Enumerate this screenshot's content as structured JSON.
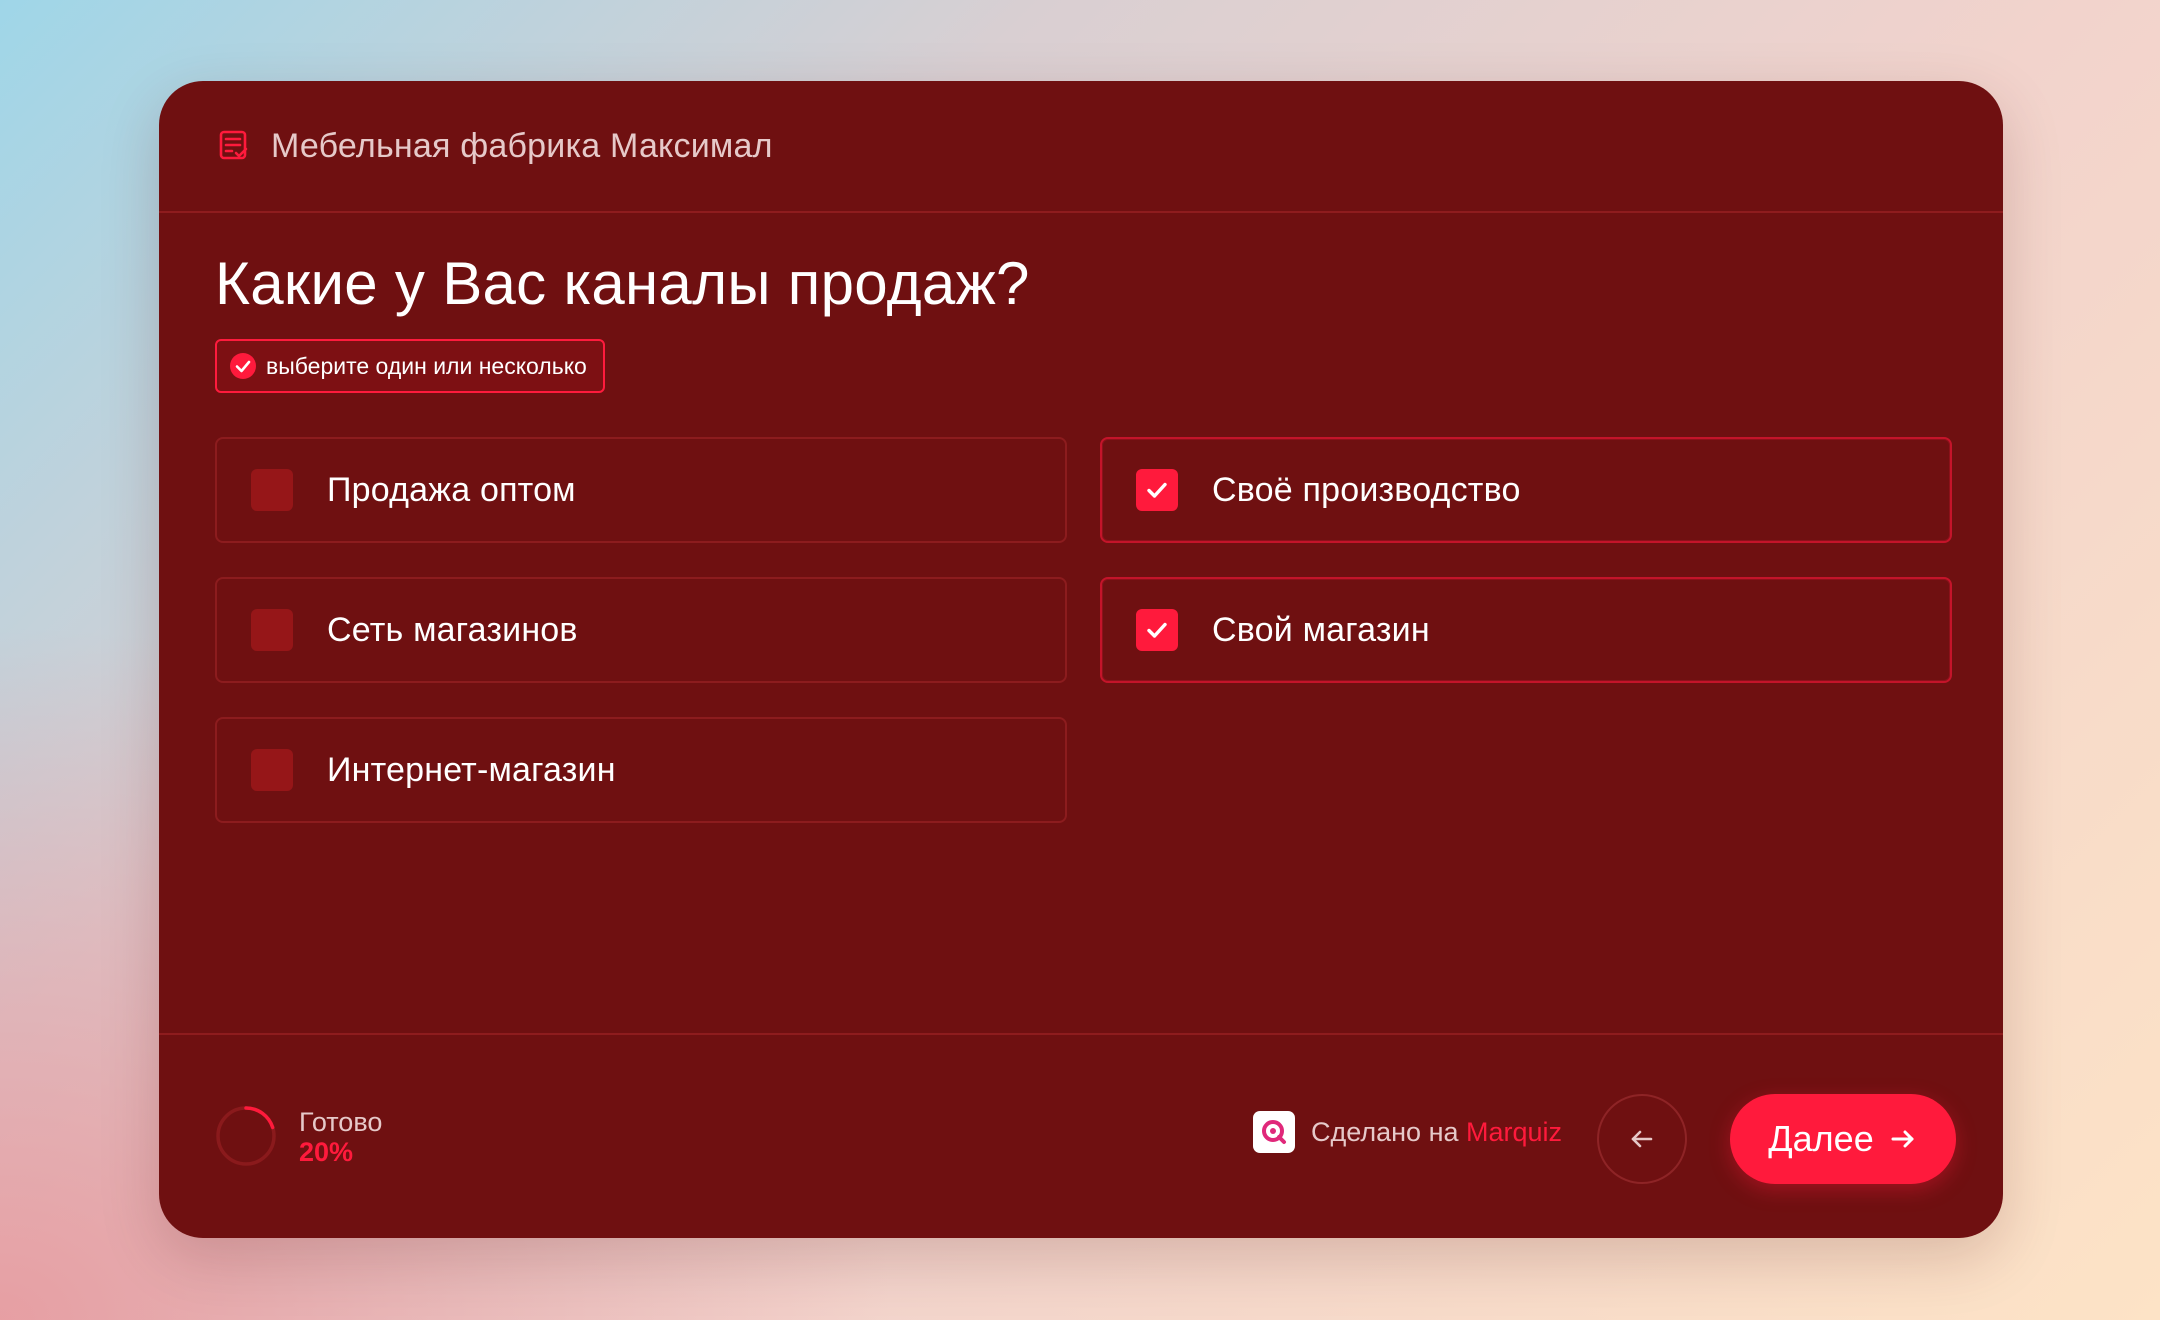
{
  "header": {
    "title": "Мебельная фабрика Максимал",
    "icon": "form-list-icon"
  },
  "question": {
    "title": "Какие у Вас каналы продаж?",
    "hint": "выберите один или несколько"
  },
  "options": [
    {
      "label": "Продажа оптом",
      "checked": false
    },
    {
      "label": "Своё производство",
      "checked": true
    },
    {
      "label": "Сеть магазинов",
      "checked": false
    },
    {
      "label": "Свой магазин",
      "checked": true
    },
    {
      "label": "Интернет-магазин",
      "checked": false
    }
  ],
  "footer": {
    "progress_label": "Готово",
    "progress_value": "20%",
    "progress_fraction": 0.2,
    "made_prefix": "Сделано на",
    "made_brand": "Marquiz",
    "next_label": "Далее"
  },
  "colors": {
    "card_background": "#6f1011",
    "accent": "#ff1a3c",
    "muted_text": "#e6c9c9"
  }
}
